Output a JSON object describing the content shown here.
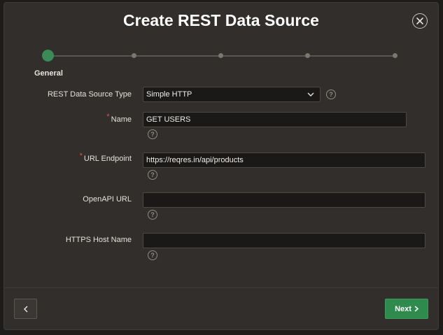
{
  "dialog": {
    "title": "Create REST Data Source"
  },
  "wizard": {
    "active_step_label": "General",
    "total_steps": 5,
    "current_step": 1
  },
  "form": {
    "type": {
      "label": "REST Data Source Type",
      "value": "Simple HTTP"
    },
    "name": {
      "label": "Name",
      "value": "GET USERS",
      "required": true
    },
    "url_endpoint": {
      "label": "URL Endpoint",
      "value": "https://reqres.in/api/products",
      "required": true
    },
    "openapi_url": {
      "label": "OpenAPI URL",
      "value": ""
    },
    "https_host": {
      "label": "HTTPS Host Name",
      "value": ""
    },
    "help_glyph": "?",
    "required_glyph": "*"
  },
  "footer": {
    "next_label": "Next"
  },
  "colors": {
    "accent": "#3b8a57",
    "next_button": "#2f8a4e",
    "required": "#d9534f",
    "background": "#312e2b"
  },
  "icons": {
    "close": "close-icon",
    "back": "chevron-left-icon",
    "next": "chevron-right-icon",
    "select": "chevron-down-icon",
    "help": "help-icon"
  }
}
